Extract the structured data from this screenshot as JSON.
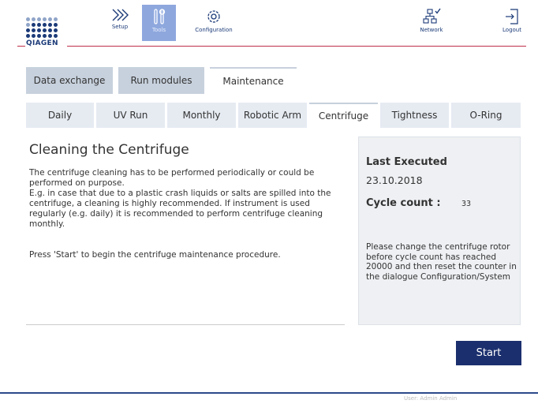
{
  "header": {
    "logo_text": "QIAGEN",
    "nav": [
      {
        "label": "Setup",
        "icon": "chevrons-right-icon"
      },
      {
        "label": "Tools",
        "icon": "tools-icon",
        "active": true
      },
      {
        "label": "Configuration",
        "icon": "gear-icon"
      },
      {
        "label": "Network",
        "icon": "network-icon"
      },
      {
        "label": "Logout",
        "icon": "logout-icon"
      }
    ]
  },
  "tabs_primary": [
    {
      "label": "Data exchange"
    },
    {
      "label": "Run modules"
    },
    {
      "label": "Maintenance",
      "active": true
    }
  ],
  "tabs_secondary": [
    {
      "label": "Daily"
    },
    {
      "label": "UV Run"
    },
    {
      "label": "Monthly"
    },
    {
      "label": "Robotic Arm"
    },
    {
      "label": "Centrifuge",
      "active": true
    },
    {
      "label": "Tightness"
    },
    {
      "label": "O-Ring"
    }
  ],
  "content": {
    "title": "Cleaning the Centrifuge",
    "paragraph1": "The centrifuge cleaning has to be performed periodically or could be performed on purpose.",
    "paragraph2": "E.g. in case that due to a plastic crash liquids or salts are spilled into the centrifuge, a cleaning is highly recommended. If instrument is used regularly (e.g. daily) it is recommended to perform centrifuge cleaning monthly.",
    "press_start": "Press 'Start' to begin the centrifuge maintenance procedure."
  },
  "panel": {
    "last_executed_label": "Last Executed",
    "last_executed_date": "23.10.2018",
    "cycle_count_label": "Cycle count :",
    "cycle_count_value": "33",
    "note": "Please change the centrifuge rotor before cycle count has reached 20000 and then reset the counter in the dialogue Configuration/System"
  },
  "start_button": "Start",
  "footer": {
    "user": "User: Admin Admin"
  },
  "colors": {
    "brand_blue": "#1b3a78",
    "accent_red": "#c0304a",
    "active_nav": "#8ea8de",
    "button_dark": "#1b2f6e",
    "tab_inactive": "#c7d1dd"
  }
}
